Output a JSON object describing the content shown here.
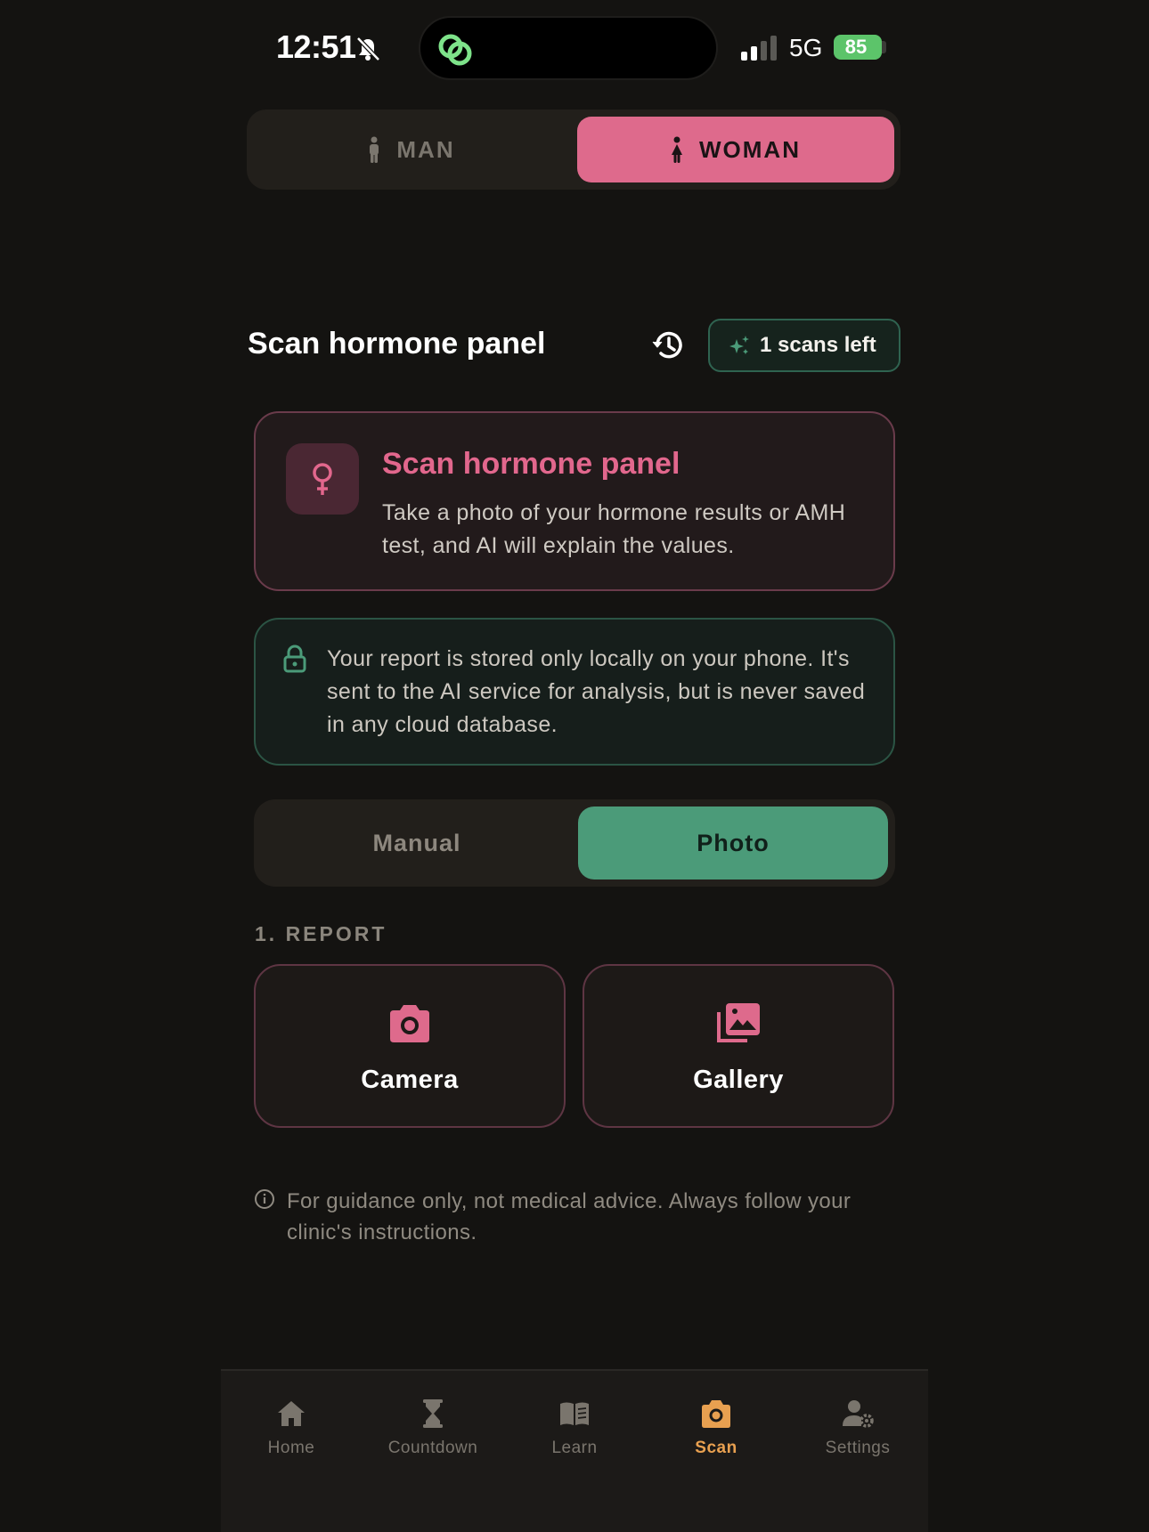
{
  "status_bar": {
    "time": "12:51",
    "network": "5G",
    "battery": "85"
  },
  "gender_toggle": {
    "man_label": "MAN",
    "woman_label": "WOMAN",
    "selected": "WOMAN"
  },
  "header": {
    "title": "Scan hormone panel",
    "scans_left": "1 scans left"
  },
  "info_card": {
    "title": "Scan hormone panel",
    "description": "Take a photo of your hormone results or AMH test, and AI will explain the values."
  },
  "privacy_card": {
    "text": "Your report is stored only locally on your phone. It's sent to the AI service for analysis, but is never saved in any cloud database."
  },
  "mode_toggle": {
    "manual_label": "Manual",
    "photo_label": "Photo",
    "selected": "Photo"
  },
  "report": {
    "section_label": "1. REPORT",
    "camera_label": "Camera",
    "gallery_label": "Gallery"
  },
  "disclaimer": {
    "text": "For guidance only, not medical advice. Always follow your clinic's instructions."
  },
  "tab_bar": {
    "items": [
      {
        "label": "Home",
        "icon": "home-icon"
      },
      {
        "label": "Countdown",
        "icon": "hourglass-icon"
      },
      {
        "label": "Learn",
        "icon": "book-icon"
      },
      {
        "label": "Scan",
        "icon": "camera-icon"
      },
      {
        "label": "Settings",
        "icon": "user-settings-icon"
      }
    ],
    "active": "Scan"
  },
  "colors": {
    "accent_pink": "#de6a8c",
    "accent_green": "#4b9b79",
    "active_tab": "#e8a050",
    "background": "#141311"
  }
}
